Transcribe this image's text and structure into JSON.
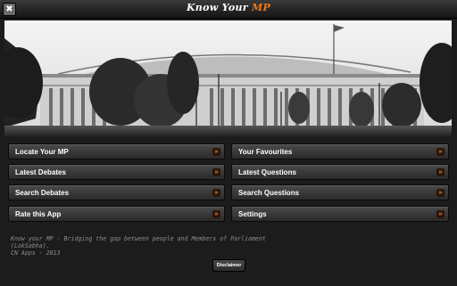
{
  "window": {
    "close_glyph": "✖",
    "title_main": "Know Your ",
    "title_accent": "MP"
  },
  "banner": {
    "icon": "parliament-house-photo"
  },
  "menu": {
    "arrow_glyph": "»",
    "arrow_color": "#ff7d1e",
    "items": [
      {
        "label": "Locate Your MP"
      },
      {
        "label": "Your Favourites"
      },
      {
        "label": "Latest Debates"
      },
      {
        "label": "Latest Questions"
      },
      {
        "label": "Search Debates"
      },
      {
        "label": "Search Questions"
      },
      {
        "label": "Rate this App"
      },
      {
        "label": "Settings"
      }
    ]
  },
  "footer": {
    "line1": "Know your MP - Bridging the gap between people and Members of Parliament",
    "line2": "(LokSabha).",
    "line3": "CN Apps - 2013",
    "disclaimer_label": "Disclaimer"
  },
  "colors": {
    "accent": "#f07a1a",
    "background": "#1c1c1c",
    "button": "#3a3a3a"
  }
}
